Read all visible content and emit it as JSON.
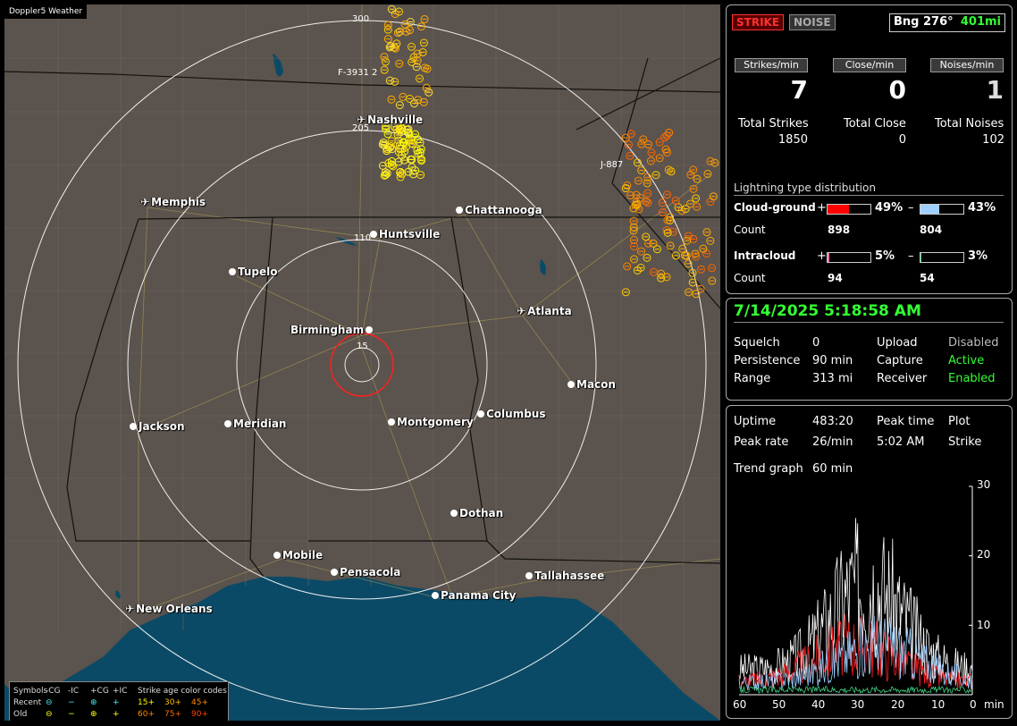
{
  "app_title": "Doppler5 Weather",
  "map": {
    "rings": [
      "300",
      "205",
      "110",
      "15"
    ],
    "storm_labels": [
      "F-3931 2",
      "J-887"
    ],
    "cities": [
      {
        "name": "Nashville",
        "type": "airport"
      },
      {
        "name": "Memphis",
        "type": "airport"
      },
      {
        "name": "Chattanooga",
        "type": "city"
      },
      {
        "name": "Huntsville",
        "type": "city"
      },
      {
        "name": "Tupelo",
        "type": "city"
      },
      {
        "name": "Atlanta",
        "type": "airport"
      },
      {
        "name": "Birmingham",
        "type": "city"
      },
      {
        "name": "Macon",
        "type": "city"
      },
      {
        "name": "Jackson",
        "type": "city"
      },
      {
        "name": "Meridian",
        "type": "city"
      },
      {
        "name": "Montgomery",
        "type": "city"
      },
      {
        "name": "Columbus",
        "type": "city"
      },
      {
        "name": "Dothan",
        "type": "city"
      },
      {
        "name": "Mobile",
        "type": "city"
      },
      {
        "name": "Pensacola",
        "type": "city"
      },
      {
        "name": "Tallahassee",
        "type": "city"
      },
      {
        "name": "Panama City",
        "type": "city"
      },
      {
        "name": "New Orleans",
        "type": "airport"
      }
    ]
  },
  "legend": {
    "symbols_label": "Symbols",
    "cols": [
      "-CG",
      "-IC",
      "+CG",
      "+IC"
    ],
    "age_label": "Strike age color codes",
    "recent_label": "Recent",
    "old_label": "Old",
    "recent_ages": [
      "15+",
      "30+",
      "45+"
    ],
    "old_ages": [
      "60+",
      "75+",
      "90+"
    ]
  },
  "top": {
    "strike_label": "STRIKE",
    "noise_label": "NOISE",
    "bearing": "Bng 276°",
    "distance": "401mi",
    "strikes_min_label": "Strikes/min",
    "close_min_label": "Close/min",
    "noises_min_label": "Noises/min",
    "strikes_min": "7",
    "close_min": "0",
    "noises_min": "1",
    "total_strikes_label": "Total Strikes",
    "total_close_label": "Total Close",
    "total_noises_label": "Total Noises",
    "total_strikes": "1850",
    "total_close": "0",
    "total_noises": "102",
    "dist_title": "Lightning type distribution",
    "cg_label": "Cloud-ground",
    "cg_pos_pct": "49%",
    "cg_neg_pct": "43%",
    "cg_pos_fraction": 0.49,
    "cg_neg_fraction": 0.43,
    "count_label": "Count",
    "cg_pos_count": "898",
    "cg_neg_count": "804",
    "ic_label": "Intracloud",
    "ic_pos_pct": "5%",
    "ic_neg_pct": "3%",
    "ic_pos_fraction": 0.05,
    "ic_neg_fraction": 0.03,
    "ic_pos_count": "94",
    "ic_neg_count": "54",
    "plus": "+",
    "minus": "–"
  },
  "status": {
    "datetime": "7/14/2025 5:18:58 AM",
    "squelch_label": "Squelch",
    "squelch": "0",
    "upload_label": "Upload",
    "upload": "Disabled",
    "persistence_label": "Persistence",
    "persistence": "90 min",
    "capture_label": "Capture",
    "capture": "Active",
    "range_label": "Range",
    "range": "313 mi",
    "receiver_label": "Receiver",
    "receiver": "Enabled"
  },
  "trend": {
    "uptime_label": "Uptime",
    "uptime": "483:20",
    "peak_time_label": "Peak time",
    "plot_label": "Plot",
    "peak_rate_label": "Peak rate",
    "peak_rate": "26/min",
    "peak_time": "5:02 AM",
    "plot_value": "Strike",
    "trend_graph_label": "Trend graph",
    "trend_graph": "60 min",
    "y_ticks": [
      "30",
      "20",
      "10"
    ],
    "x_ticks": [
      "60",
      "50",
      "40",
      "30",
      "20",
      "10",
      "0"
    ],
    "x_unit": "min"
  },
  "colors": {
    "strike_red": "#ff3030",
    "green": "#33ff33",
    "cg_pos": "#ff0000",
    "cg_neg": "#a0d0ff",
    "ic_pos": "#ff70b0",
    "ic_neg": "#40d080",
    "water": "#0b4a66",
    "land": "#5b534d"
  }
}
